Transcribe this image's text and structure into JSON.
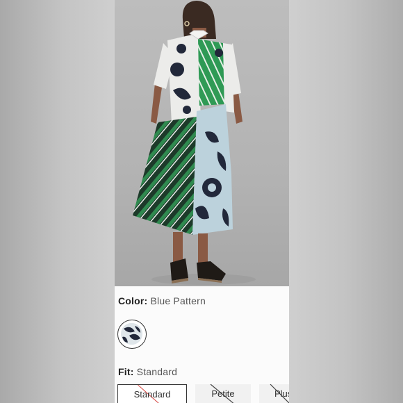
{
  "product": {
    "image_alt": "Back view of a model wearing a patchwork shirt dress with floral and green striped panels",
    "color_label": "Color:",
    "color_value": "Blue Pattern",
    "swatches": [
      {
        "name": "Blue Pattern",
        "selected": true
      }
    ],
    "fit_label": "Fit:",
    "fit_value": "Standard",
    "fit_options": [
      {
        "label": "Standard",
        "selected": true,
        "available": false
      },
      {
        "label": "Petite",
        "selected": false,
        "available": false
      },
      {
        "label": "Plus",
        "selected": false,
        "available": false
      }
    ]
  },
  "colors": {
    "accent_green": "#2f8a4f",
    "navy": "#22283a",
    "light_blue": "#bcd2dc"
  }
}
